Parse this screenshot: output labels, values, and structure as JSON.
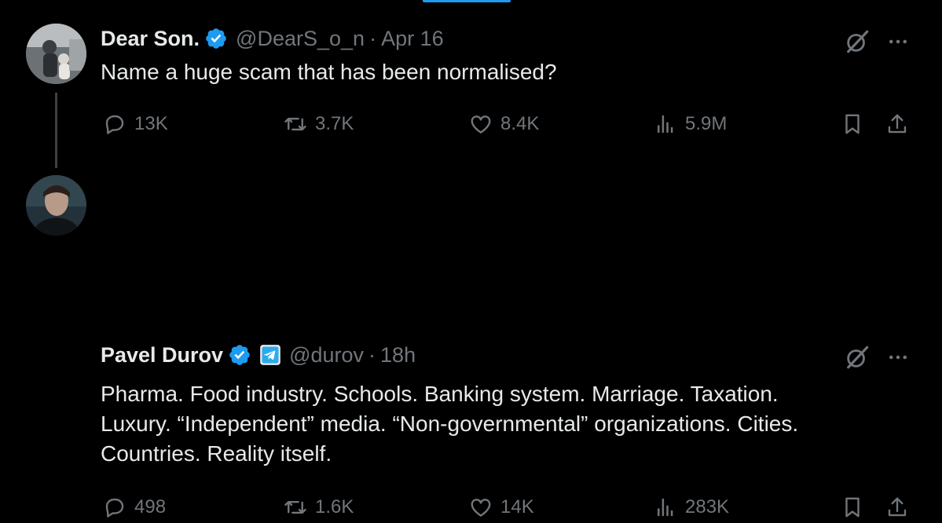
{
  "tweets": [
    {
      "author": {
        "name": "Dear Son.",
        "handle": "@DearS_o_n",
        "verified": true,
        "avatar": "dear-son-avatar"
      },
      "separator": "·",
      "time": "Apr 16",
      "body_lines": [
        "Name a huge scam that has been normalised?"
      ],
      "stats": {
        "replies": "13K",
        "reposts": "3.7K",
        "likes": "8.4K",
        "views": "5.9M"
      }
    },
    {
      "author": {
        "name": "Pavel Durov",
        "handle": "@durov",
        "verified": true,
        "affiliate_badge": "telegram-icon",
        "avatar": "pavel-durov-avatar"
      },
      "separator": "·",
      "time": "18h",
      "body_lines": [
        "Pharma. Food industry. Schools. Banking system. Marriage. Taxation.",
        "Luxury. “Independent” media. “Non-governmental” organizations. Cities.",
        "Countries. Reality itself."
      ],
      "stats": {
        "replies": "498",
        "reposts": "1.6K",
        "likes": "14K",
        "views": "283K"
      }
    }
  ],
  "colors": {
    "background": "#000000",
    "text": "#e7e9ea",
    "muted": "#71767b",
    "verified": "#1d9bf0",
    "thread_line": "#3e4144"
  }
}
